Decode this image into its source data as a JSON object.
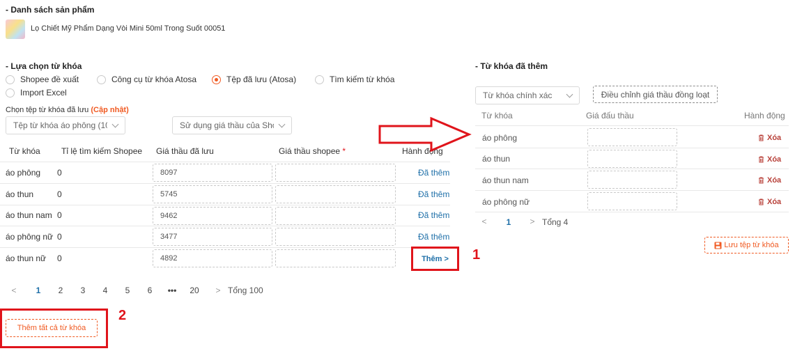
{
  "product_section": {
    "title": "- Danh sách sản phẩm",
    "product_name": "Lọ Chiết Mỹ Phẩm Dạng Vòi Mini 50ml Trong Suốt 00051"
  },
  "keyword_select": {
    "title": "- Lựa chọn từ khóa",
    "options": [
      {
        "label": "Shopee đề xuất",
        "selected": false
      },
      {
        "label": "Công cụ từ khóa Atosa",
        "selected": false
      },
      {
        "label": "Tệp đã lưu (Atosa)",
        "selected": true
      },
      {
        "label": "Tìm kiếm từ khóa",
        "selected": false
      },
      {
        "label": "Import Excel",
        "selected": false
      }
    ],
    "file_label": "Chọn tệp từ khóa đã lưu",
    "file_update_link": "(Cập nhật)",
    "file_select_value": "Tệp từ khóa áo phông (10",
    "bid_select_value": "Sử dụng giá thầu của Sho"
  },
  "left_table": {
    "headers": {
      "keyword": "Từ khóa",
      "ratio": "Tỉ lệ tìm kiếm Shopee",
      "saved_bid": "Giá thầu đã lưu",
      "shopee_bid": "Giá thầu shopee",
      "required_mark": "*",
      "action": "Hành động"
    },
    "rows": [
      {
        "keyword": "áo phông",
        "ratio": "0",
        "saved_bid": "8097",
        "shopee_bid": "",
        "action": "Đã thêm"
      },
      {
        "keyword": "áo thun",
        "ratio": "0",
        "saved_bid": "5745",
        "shopee_bid": "",
        "action": "Đã thêm"
      },
      {
        "keyword": "áo thun nam",
        "ratio": "0",
        "saved_bid": "9462",
        "shopee_bid": "",
        "action": "Đã thêm"
      },
      {
        "keyword": "áo phông nữ",
        "ratio": "0",
        "saved_bid": "3477",
        "shopee_bid": "",
        "action": "Đã thêm"
      },
      {
        "keyword": "áo thun nữ",
        "ratio": "0",
        "saved_bid": "4892",
        "shopee_bid": "",
        "action": "Thêm >"
      }
    ],
    "pagination": {
      "pages": [
        "1",
        "2",
        "3",
        "4",
        "5",
        "6",
        "•••",
        "20"
      ],
      "active": "1",
      "prev": "<",
      "next": ">",
      "total": "Tổng 100"
    },
    "add_all_button": "Thêm tất cả từ khóa"
  },
  "right_panel": {
    "title": "- Từ khóa đã thêm",
    "match_select_value": "Từ khóa chính xác",
    "adjust_button": "Điều chỉnh giá thầu đồng loạt",
    "headers": {
      "keyword": "Từ khóa",
      "bid": "Giá đấu thầu",
      "action": "Hành động"
    },
    "rows": [
      {
        "keyword": "áo phông",
        "bid": "",
        "action": "Xóa"
      },
      {
        "keyword": "áo thun",
        "bid": "",
        "action": "Xóa"
      },
      {
        "keyword": "áo thun nam",
        "bid": "",
        "action": "Xóa"
      },
      {
        "keyword": "áo phông nữ",
        "bid": "",
        "action": "Xóa"
      }
    ],
    "pagination": {
      "prev": "<",
      "page": "1",
      "next": ">",
      "total": "Tổng 4"
    },
    "save_button": "Lưu tệp từ khóa"
  },
  "annotations": {
    "label_1": "1",
    "label_2": "2",
    "highlight_color": "#e0141b"
  },
  "colors": {
    "accent_orange": "#f05a22",
    "link_blue": "#1e6fa8",
    "delete_red": "#b8413a"
  }
}
